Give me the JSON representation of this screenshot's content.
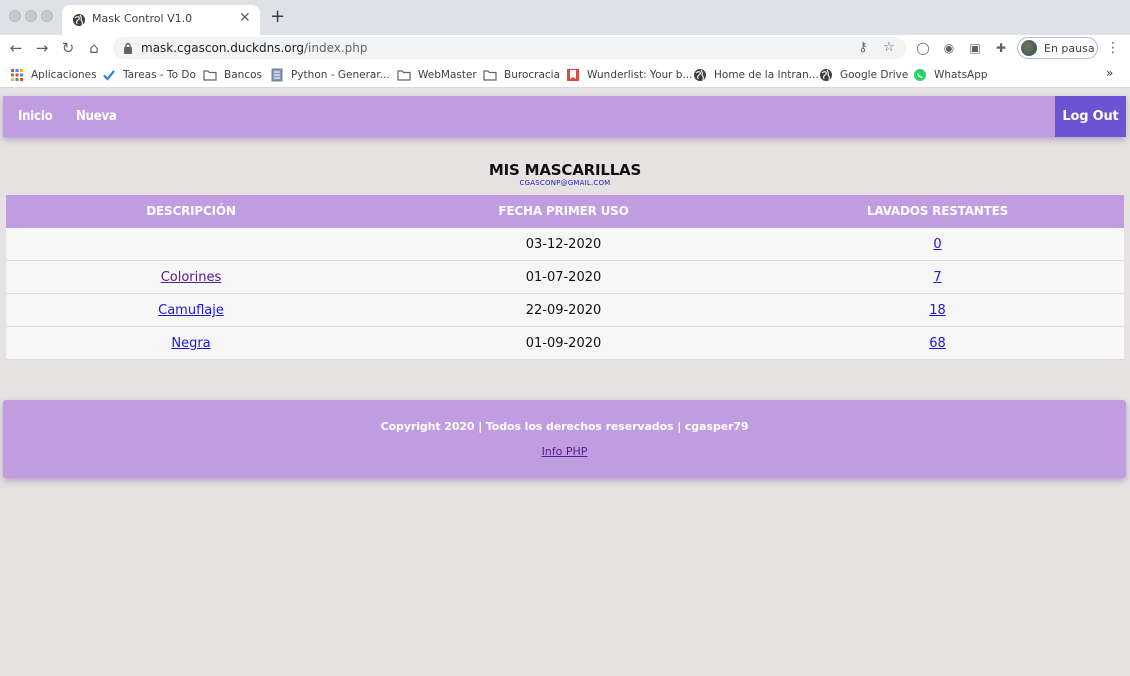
{
  "browser": {
    "tab_title": "Mask Control V1.0",
    "url_host": "mask.cgascon.duckdns.org",
    "url_path": "/index.php",
    "profile_label": "En pausa",
    "bookmarks": [
      {
        "label": "Aplicaciones",
        "icon": "apps-grid-icon"
      },
      {
        "label": "Tareas - To Do",
        "icon": "checkmark-icon"
      },
      {
        "label": "Bancos",
        "icon": "folder-icon"
      },
      {
        "label": "Python - Generar...",
        "icon": "document-icon"
      },
      {
        "label": "WebMaster",
        "icon": "folder-icon"
      },
      {
        "label": "Burocracia",
        "icon": "folder-icon"
      },
      {
        "label": "Wunderlist: Your b...",
        "icon": "wunderlist-icon"
      },
      {
        "label": "Home de la Intran...",
        "icon": "globe-icon"
      },
      {
        "label": "Google Drive",
        "icon": "globe-icon"
      },
      {
        "label": "WhatsApp",
        "icon": "whatsapp-icon"
      }
    ],
    "more_bookmarks": "»"
  },
  "nav": {
    "inicio": "Inicio",
    "nueva": "Nueva",
    "logout": "Log Out"
  },
  "page": {
    "title": "MIS MASCARILLAS",
    "email": "CGASCONP@GMAIL.COM"
  },
  "table": {
    "headers": [
      "DESCRIPCIÓN",
      "FECHA PRIMER USO",
      "LAVADOS RESTANTES"
    ],
    "rows": [
      {
        "descripcion": "",
        "fecha": "03-12-2020",
        "lavados": "0"
      },
      {
        "descripcion": "Colorines",
        "fecha": "01-07-2020",
        "lavados": "7"
      },
      {
        "descripcion": "Camuflaje",
        "fecha": "22-09-2020",
        "lavados": "18"
      },
      {
        "descripcion": "Negra",
        "fecha": "01-09-2020",
        "lavados": "68"
      }
    ]
  },
  "footer": {
    "copyright": "Copyright 2020 | Todos los derechos reservados | cgasper79",
    "info_link": "Info PHP"
  },
  "colors": {
    "accent": "#c09de0",
    "logout": "#6b54d2",
    "background": "#e6e2e1",
    "link": "#1a1ad6",
    "visited_link": "#551a8b"
  }
}
